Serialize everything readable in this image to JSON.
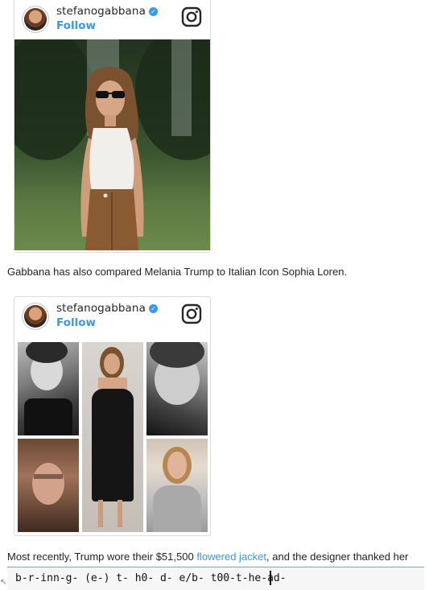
{
  "post1": {
    "username": "stefanogabbana",
    "follow_label": "Follow"
  },
  "paragraph1": "Gabbana has also compared Melania Trump to Italian Icon Sophia Loren.",
  "post2": {
    "username": "stefanogabbana",
    "follow_label": "Follow"
  },
  "paragraph2": {
    "prefix": "Most recently, Trump wore their $51,500 ",
    "link_text": "flowered jacket",
    "suffix": ", and the designer thanked her"
  },
  "ticker": {
    "text": "b-r-inn-g- (e-) t- h0- d- e/b- t00-t-he-ad-"
  },
  "colors": {
    "link": "#3897f0",
    "verified": "#3897f0",
    "text": "#222222",
    "border": "#dbdbdb"
  },
  "icons": [
    "verified-badge-icon",
    "instagram-icon"
  ]
}
